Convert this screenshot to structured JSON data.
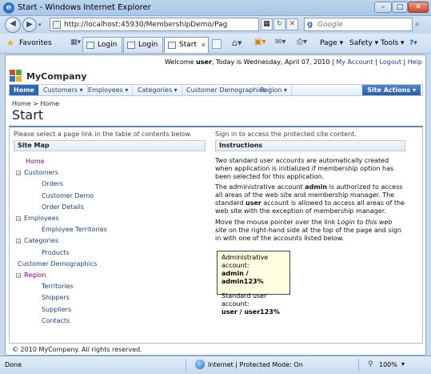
{
  "window": {
    "title": "Start - Windows Internet Explorer",
    "minimize": "–",
    "maximize": "□",
    "close": "✕"
  },
  "address_bar": {
    "url": "http://localhost:45930/MembershipDemo/Pag",
    "search_placeholder": "Google",
    "back": "◀",
    "forward": "▶",
    "refresh": "↻",
    "stop": "✕",
    "go": "→"
  },
  "favorites_bar": {
    "favorites_label": "Favorites",
    "tabs": [
      {
        "label": "Login"
      },
      {
        "label": "Login"
      },
      {
        "label": "Start"
      }
    ],
    "commands": [
      "Page ▾",
      "Safety ▾",
      "Tools ▾",
      "?▾"
    ]
  },
  "site": {
    "topbar": {
      "welcome_prefix": "Welcome ",
      "user": "user",
      "date_text": ", Today is Wednesday, April 07, 2010",
      "my_account": "My Account",
      "logout": "Logout",
      "help": "Help",
      "sep": "|"
    },
    "brand": "MyCompany",
    "menu": [
      "Home",
      "Customers ▾",
      "Employees ▾",
      "Categories ▾",
      "Customer Demographics",
      "Region ▾"
    ],
    "site_actions": "Site Actions ▾",
    "breadcrumb": "Home > Home",
    "page_title": "Start",
    "left_hint": "Please select a page link in the table of contents below.",
    "right_hint": "Sign in to access the protected site content.",
    "site_map_header": "Site Map",
    "instructions_header": "Instructions",
    "site_map": [
      {
        "label": "Home",
        "level": 0,
        "toggle": "",
        "current": true
      },
      {
        "label": "Customers",
        "level": 0,
        "toggle": "−"
      },
      {
        "label": "Orders",
        "level": 1
      },
      {
        "label": "Customer Demo",
        "level": 1
      },
      {
        "label": "Order Details",
        "level": 1
      },
      {
        "label": "Employees",
        "level": 0,
        "toggle": "−"
      },
      {
        "label": "Employee Territories",
        "level": 1
      },
      {
        "label": "Categories",
        "level": 0,
        "toggle": "−"
      },
      {
        "label": "Products",
        "level": 1
      },
      {
        "label": "Customer Demographics",
        "level": 0,
        "toggle": ""
      },
      {
        "label": "Region",
        "level": 0,
        "toggle": "−",
        "current": true
      },
      {
        "label": "Territories",
        "level": 1
      },
      {
        "label": "Shippers",
        "level": 1
      },
      {
        "label": "Suppliers",
        "level": 1
      },
      {
        "label": "Contacts",
        "level": 1
      }
    ],
    "instructions": {
      "p1": "Two standard user accounts are automatically created when application is initialized if membership option has been selected for this application.",
      "p2_a": "The administrative account ",
      "p2_admin": "admin",
      "p2_b": " is authorized to access all areas of the web site and membership manager. The standard ",
      "p2_user": "user",
      "p2_c": " account is allowed to access all areas of the web site with the exception of membership manager.",
      "p3_a": "Move the mouse pointer over the link ",
      "p3_link": "Login to this web site",
      "p3_b": " on the right-hand side at the top of the page and sign in with one of the accounts listed below.",
      "admin_label": "Administrative account:",
      "admin_creds": "admin / admin123%",
      "user_label": "Standard user account:",
      "user_creds": "user / user123%"
    },
    "footer": "© 2010 MyCompany. All rights reserved."
  },
  "status_bar": {
    "status": "Done",
    "zone": "Internet | Protected Mode: On",
    "zoom": "100%"
  }
}
